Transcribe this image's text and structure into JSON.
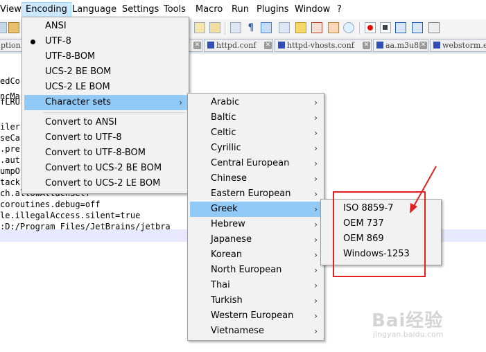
{
  "menubar": {
    "items": [
      "View",
      "Encoding",
      "Language",
      "Settings",
      "Tools",
      "Macro",
      "Run",
      "Plugins",
      "Window",
      "?"
    ],
    "active": "Encoding"
  },
  "tabs": [
    {
      "label": "ption",
      "truncated": true
    },
    {
      "label": "httpd.conf"
    },
    {
      "label": "httpd-vhosts.conf"
    },
    {
      "label": "aa.m3u8"
    },
    {
      "label": "webstorm.e"
    }
  ],
  "editor": {
    "lines": [
      "edCo",
      "ncMa",
      "fLRU",
      "",
      "iler",
      "seCa",
      ".pre",
      ".aut",
      "umpO",
      "tack",
      "ch.allowAttachSelf",
      "coroutines.debug=off",
      "le.illegalAccess.silent=true",
      ":D:/Program Files/JetBrains/jetbra"
    ]
  },
  "encoding_menu": {
    "items": [
      "ANSI",
      "UTF-8",
      "UTF-8-BOM",
      "UCS-2 BE BOM",
      "UCS-2 LE BOM",
      "Character sets"
    ],
    "checked": "UTF-8",
    "highlighted": "Character sets",
    "convert_items": [
      "Convert to ANSI",
      "Convert to UTF-8",
      "Convert to UTF-8-BOM",
      "Convert to UCS-2 BE BOM",
      "Convert to UCS-2 LE BOM"
    ],
    "submenu_arrow": "›"
  },
  "charsets_menu": {
    "items": [
      "Arabic",
      "Baltic",
      "Celtic",
      "Cyrillic",
      "Central European",
      "Chinese",
      "Eastern European",
      "Greek",
      "Hebrew",
      "Japanese",
      "Korean",
      "North European",
      "Thai",
      "Turkish",
      "Western European",
      "Vietnamese"
    ],
    "highlighted": "Greek"
  },
  "greek_menu": {
    "items": [
      "ISO 8859-7",
      "OEM 737",
      "OEM 869",
      "Windows-1253"
    ]
  },
  "annotation": {
    "color": "#e02020"
  },
  "watermark": {
    "brand": "Bai经验",
    "site": "jingyan.baidu.com"
  },
  "colors": {
    "menu_highlight": "#91c9f7",
    "menubar_active": "#cce8ff",
    "line_highlight": "#e8e8ff"
  }
}
